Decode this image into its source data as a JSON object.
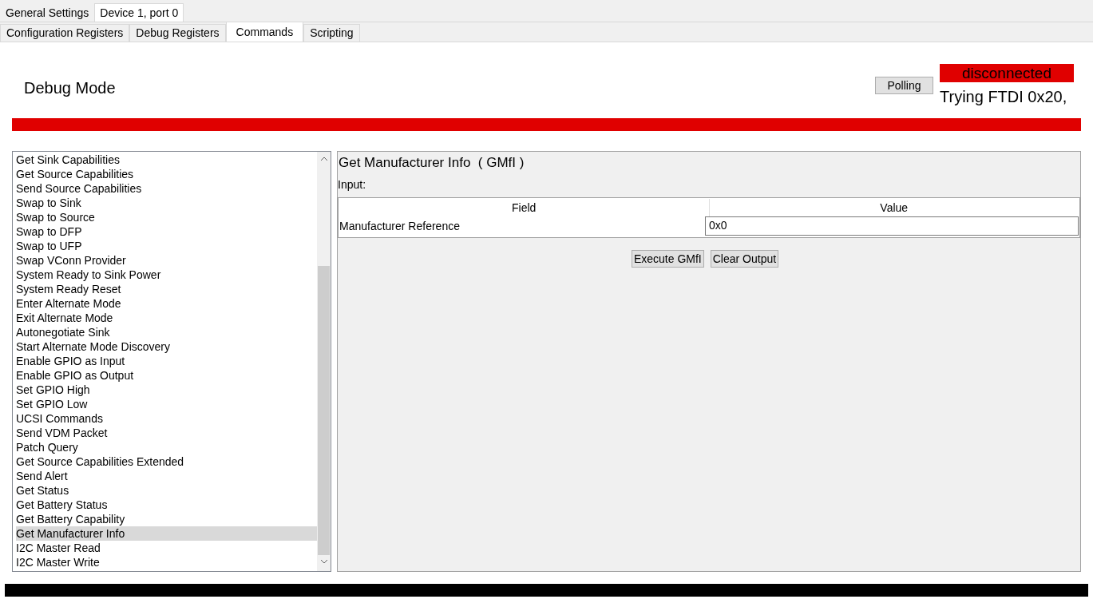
{
  "top_tabs": [
    {
      "label": "General Settings",
      "selected": false
    },
    {
      "label": "Device 1, port 0",
      "selected": true
    }
  ],
  "sub_tabs": [
    {
      "label": "Configuration Registers",
      "selected": false
    },
    {
      "label": "Debug Registers",
      "selected": false
    },
    {
      "label": "Commands",
      "selected": true
    },
    {
      "label": "Scripting",
      "selected": false
    }
  ],
  "header": {
    "title": "Debug Mode",
    "polling_button": "Polling",
    "status": "disconnected",
    "connected": false,
    "message": "Trying FTDI 0x20,"
  },
  "commands": [
    {
      "label": "Get Sink Capabilities",
      "selected": false
    },
    {
      "label": "Get Source Capabilities",
      "selected": false
    },
    {
      "label": "Send Source Capabilities",
      "selected": false
    },
    {
      "label": "Swap to Sink",
      "selected": false
    },
    {
      "label": "Swap to Source",
      "selected": false
    },
    {
      "label": "Swap to DFP",
      "selected": false
    },
    {
      "label": "Swap to UFP",
      "selected": false
    },
    {
      "label": "Swap VConn Provider",
      "selected": false
    },
    {
      "label": "System Ready to Sink Power",
      "selected": false
    },
    {
      "label": "System Ready Reset",
      "selected": false
    },
    {
      "label": "Enter Alternate Mode",
      "selected": false
    },
    {
      "label": "Exit Alternate Mode",
      "selected": false
    },
    {
      "label": "Autonegotiate Sink",
      "selected": false
    },
    {
      "label": "Start Alternate Mode Discovery",
      "selected": false
    },
    {
      "label": "Enable GPIO as Input",
      "selected": false
    },
    {
      "label": "Enable GPIO as Output",
      "selected": false
    },
    {
      "label": "Set GPIO High",
      "selected": false
    },
    {
      "label": "Set GPIO Low",
      "selected": false
    },
    {
      "label": "UCSI Commands",
      "selected": false
    },
    {
      "label": "Send VDM Packet",
      "selected": false
    },
    {
      "label": "Patch Query",
      "selected": false
    },
    {
      "label": "Get Source Capabilities Extended",
      "selected": false
    },
    {
      "label": "Send Alert",
      "selected": false
    },
    {
      "label": "Get Status",
      "selected": false
    },
    {
      "label": "Get Battery Status",
      "selected": false
    },
    {
      "label": "Get Battery Capability",
      "selected": false
    },
    {
      "label": "Get Manufacturer Info",
      "selected": true
    },
    {
      "label": "I2C Master Read",
      "selected": false
    },
    {
      "label": "I2C Master Write",
      "selected": false
    }
  ],
  "detail": {
    "title": "Get Manufacturer Info  ( GMfI )",
    "input_label": "Input:",
    "columns": [
      "Field",
      "Value"
    ],
    "rows": [
      {
        "field": "Manufacturer Reference",
        "value": "0x0"
      }
    ],
    "buttons": [
      "Execute GMfI",
      "Clear Output"
    ]
  }
}
